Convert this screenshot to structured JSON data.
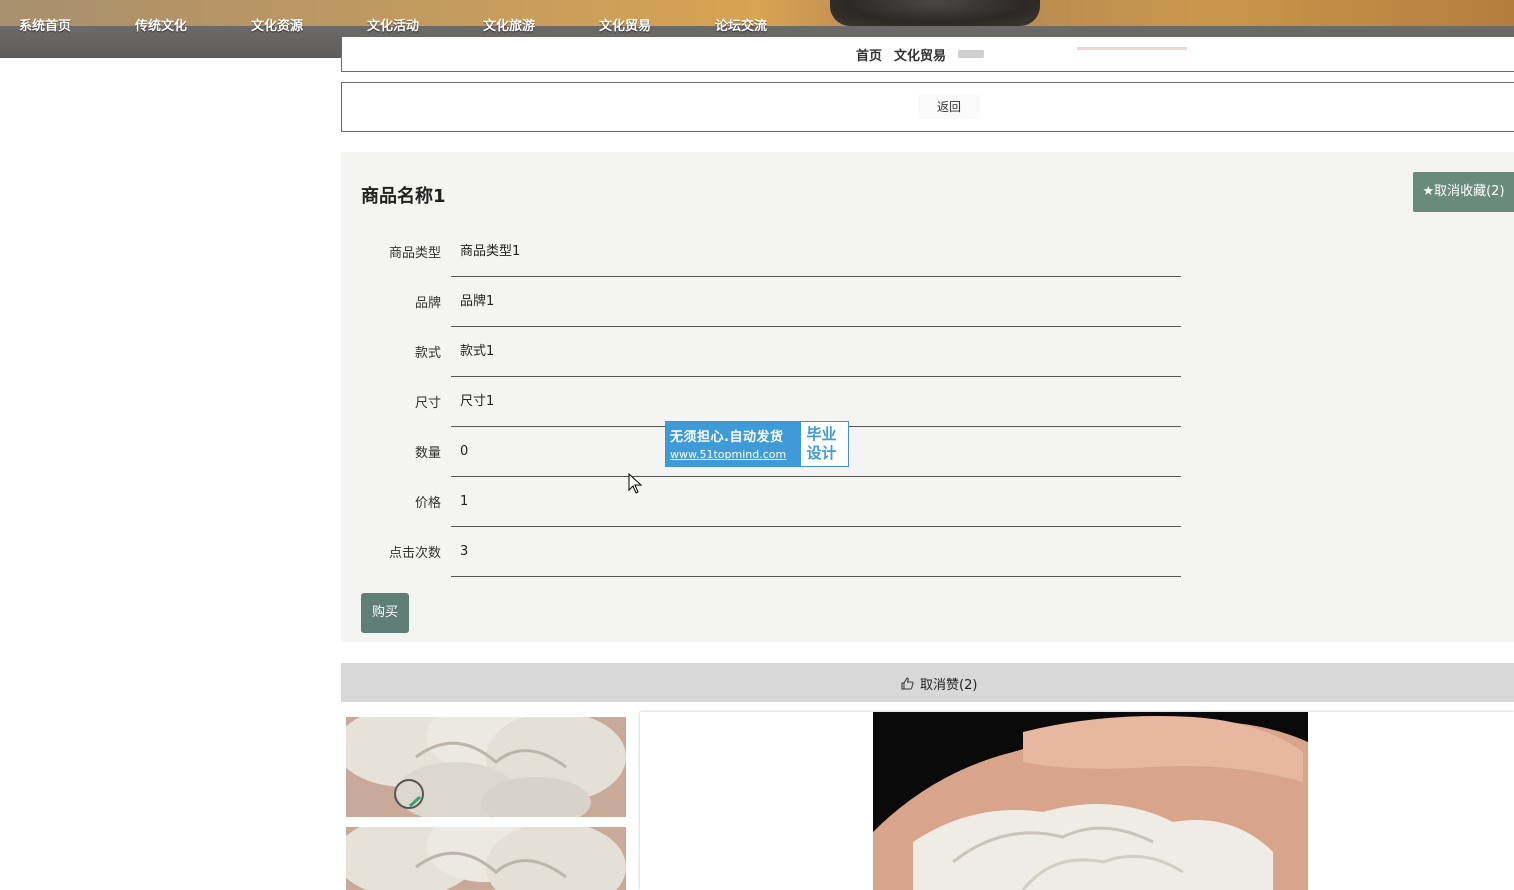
{
  "nav": {
    "items": [
      "系统首页",
      "传统文化",
      "文化资源",
      "文化活动",
      "文化旅游",
      "文化贸易",
      "论坛交流"
    ]
  },
  "breadcrumb": {
    "home": "首页",
    "current": "文化贸易"
  },
  "back": {
    "label": "返回"
  },
  "product": {
    "title": "商品名称1",
    "favorite_label": "★取消收藏(2)",
    "fields": [
      {
        "label": "商品类型",
        "value": "商品类型1"
      },
      {
        "label": "品牌",
        "value": "品牌1"
      },
      {
        "label": "款式",
        "value": "款式1"
      },
      {
        "label": "尺寸",
        "value": "尺寸1"
      },
      {
        "label": "数量",
        "value": "0"
      },
      {
        "label": "价格",
        "value": "1"
      },
      {
        "label": "点击次数",
        "value": "3"
      }
    ],
    "buy_label": "购买"
  },
  "like": {
    "label": "取消赞(2)"
  },
  "watermark": {
    "line1": "无须担心.自动发货",
    "line2": "www.51topmind.com",
    "right_top": "毕业",
    "right_bottom": "设计"
  },
  "colors": {
    "button_green": "#5f7f76",
    "favorite_green": "#6a8a7e",
    "watermark_blue": "#3f9bd8",
    "panel_bg": "#f4f4f2",
    "like_bar_bg": "#d8d8d8"
  }
}
